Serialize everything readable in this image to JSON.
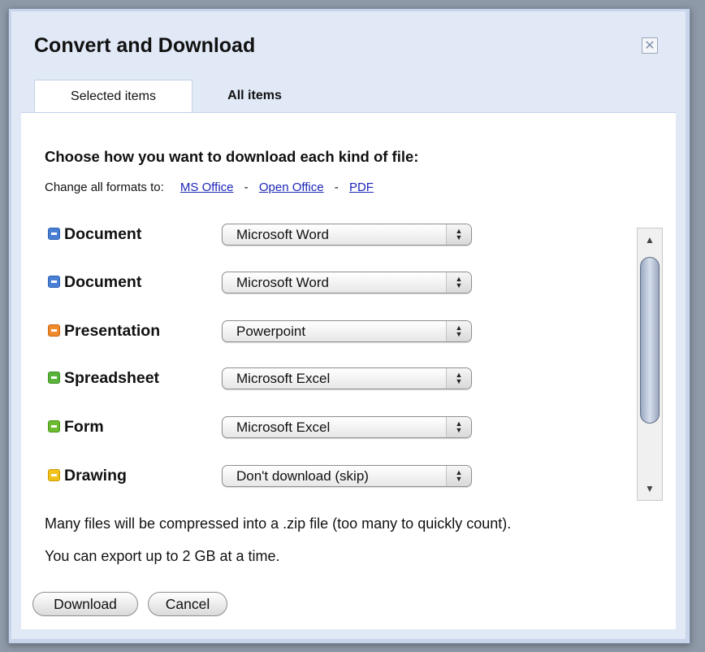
{
  "dialog": {
    "title": "Convert and Download",
    "close_glyph": "✕"
  },
  "tabs": [
    {
      "label": "Selected items",
      "active": true
    },
    {
      "label": "All items",
      "active": false
    }
  ],
  "heading": "Choose how you want to download each kind of file:",
  "change_formats": {
    "label": "Change all formats to:",
    "options": [
      "MS Office",
      "Open Office",
      "PDF"
    ],
    "separator": "-"
  },
  "files": [
    {
      "type": "Document",
      "icon": "document-icon",
      "color": "#4a7fd6",
      "format": "Microsoft Word"
    },
    {
      "type": "Document",
      "icon": "document-icon",
      "color": "#4a7fd6",
      "format": "Microsoft Word"
    },
    {
      "type": "Presentation",
      "icon": "presentation-icon",
      "color": "#f08a2c",
      "format": "Powerpoint"
    },
    {
      "type": "Spreadsheet",
      "icon": "spreadsheet-icon",
      "color": "#5ab43c",
      "format": "Microsoft Excel"
    },
    {
      "type": "Form",
      "icon": "form-icon",
      "color": "#6cbb2f",
      "format": "Microsoft Excel"
    },
    {
      "type": "Drawing",
      "icon": "drawing-icon",
      "color": "#f2c21a",
      "format": "Don't download (skip)"
    }
  ],
  "scrollbar": {
    "up_glyph": "▲",
    "down_glyph": "▼"
  },
  "info": {
    "compress_note": "Many files will be compressed into a .zip file (too many to quickly count).",
    "limit_note": "You can export up to 2 GB at a time."
  },
  "buttons": {
    "download": "Download",
    "cancel": "Cancel"
  }
}
